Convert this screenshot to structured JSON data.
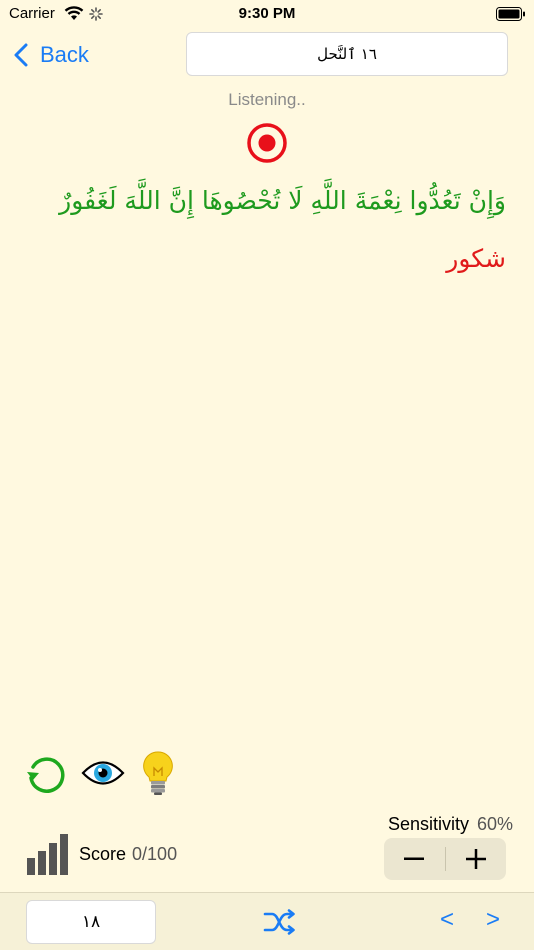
{
  "status_bar": {
    "carrier": "Carrier",
    "time": "9:30 PM"
  },
  "nav": {
    "back_label": "Back",
    "surah_field_value": "١٦ ٱلنَّحل"
  },
  "recorder": {
    "status_text": "Listening.."
  },
  "content": {
    "verse_text": "وَإِنْ تَعُدُّوا نِعْمَةَ اللَّهِ لَا تُحْصُوهَا إِنَّ اللَّهَ لَغَفُورٌ",
    "next_word": "شكور"
  },
  "controls": {
    "sensitivity_label": "Sensitivity",
    "sensitivity_value": "60%",
    "score_label": "Score",
    "score_value": "0/100"
  },
  "bottom_bar": {
    "page_field_value": "١٨",
    "prev_label": "<",
    "next_label": ">"
  },
  "icons": {
    "back": "chevron-left-icon",
    "record": "record-icon",
    "refresh": "refresh-icon",
    "eye": "eye-icon",
    "hint": "lightbulb-icon",
    "score": "bar-chart-icon",
    "shuffle": "shuffle-icon"
  },
  "colors": {
    "accent": "#1a7cf5",
    "verse": "#1e9a1e",
    "word": "#e01a1a",
    "record": "#e8101a",
    "background": "#fff9e0"
  }
}
